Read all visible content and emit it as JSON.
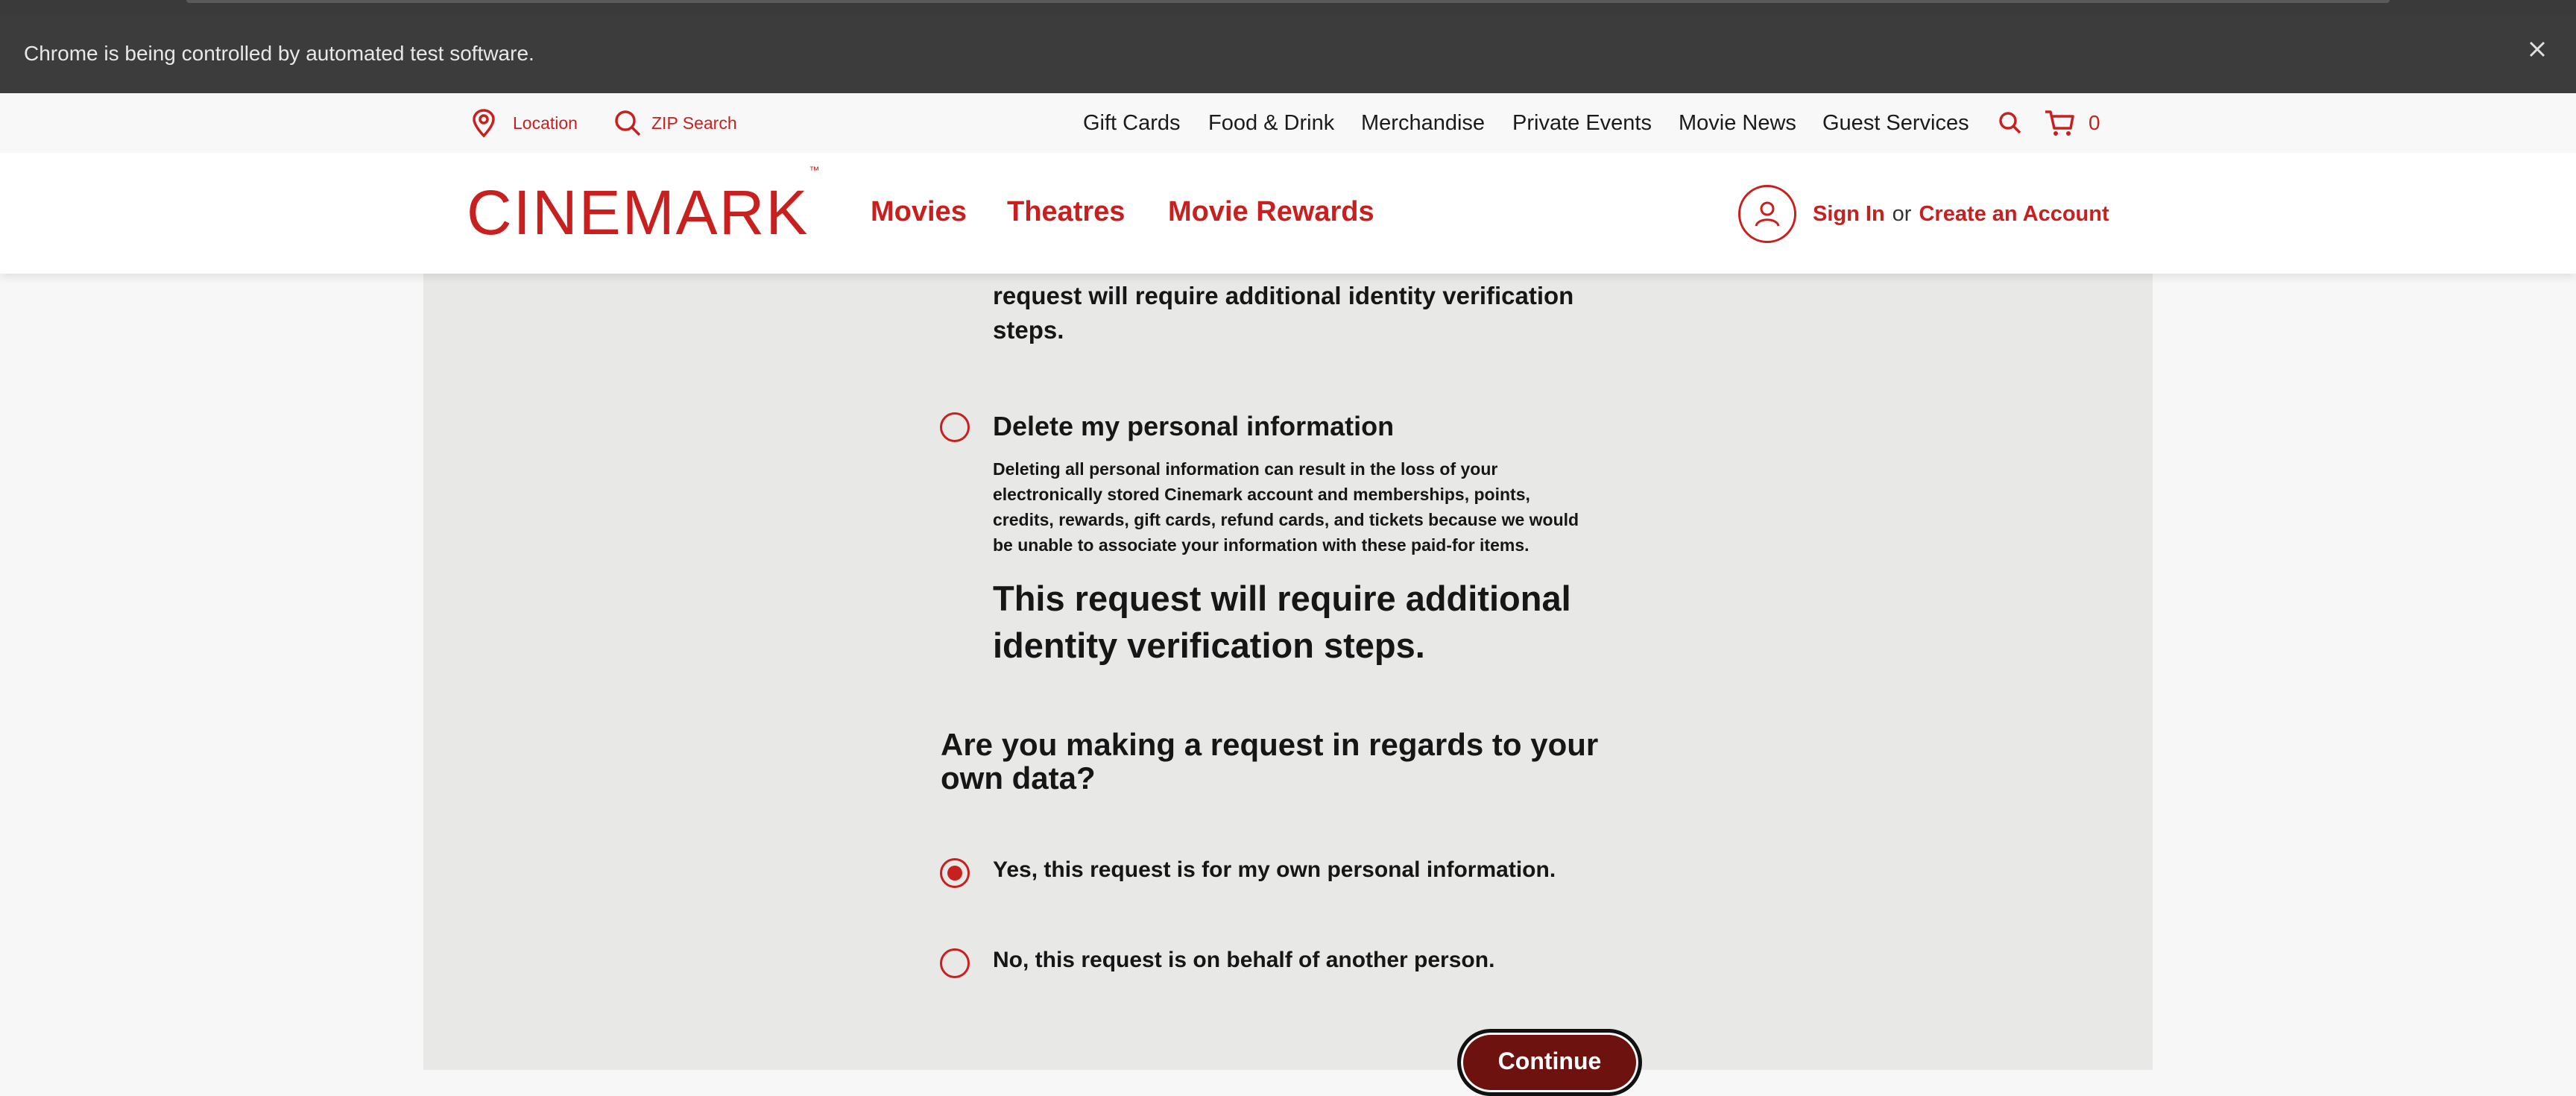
{
  "browser": {
    "automation_message": "Chrome is being controlled by automated test software."
  },
  "utility_bar": {
    "location_label": "Location",
    "zip_search_label": "ZIP Search",
    "nav_items": [
      "Gift Cards",
      "Food & Drink",
      "Merchandise",
      "Private Events",
      "Movie News",
      "Guest Services"
    ],
    "cart_count": "0"
  },
  "header": {
    "logo_text": "CINEMARK",
    "logo_mark": "™",
    "nav": [
      "Movies",
      "Theatres",
      "Movie Rewards"
    ],
    "sign_in": "Sign In",
    "or_text": "or",
    "create_account": "Create an Account"
  },
  "form": {
    "partial_verification_line1": "request will require additional identity verification",
    "partial_verification_line2": "steps.",
    "delete_option": {
      "label": "Delete my personal information",
      "description_lines": [
        "Deleting all personal information can result in the loss of your",
        "electronically stored Cinemark account and memberships, points,",
        "credits, rewards, gift cards, refund cards, and tickets because we would",
        "be unable to associate your information with these paid-for items."
      ],
      "verification_lines": [
        "This request will require additional",
        "identity verification steps."
      ],
      "selected": false
    },
    "own_data_question_lines": [
      "Are you making a request in regards to your",
      "own data?"
    ],
    "own_data_options": [
      {
        "label": "Yes, this request is for my own personal information.",
        "selected": true
      },
      {
        "label": "No, this request is on behalf of another person.",
        "selected": false
      }
    ],
    "continue_label": "Continue"
  },
  "colors": {
    "brand_red": "#c8201e",
    "continue_bg": "#6e1210",
    "panel_bg": "#e8e8e6",
    "automation_bar_bg": "#3c3c3c"
  }
}
